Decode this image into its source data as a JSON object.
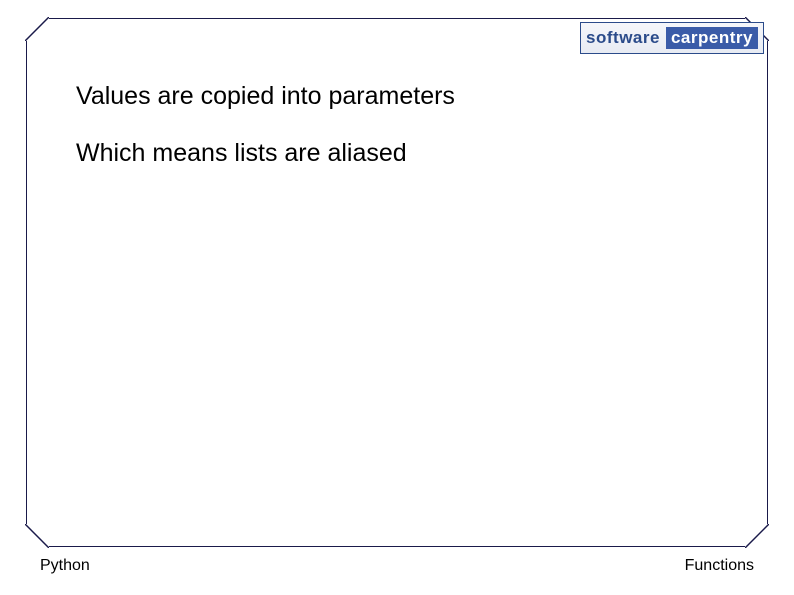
{
  "logo": {
    "word1": "software",
    "word2": "carpentry"
  },
  "content": {
    "lines": [
      "Values are copied into parameters",
      "Which means lists are aliased"
    ]
  },
  "footer": {
    "left": "Python",
    "right": "Functions"
  }
}
